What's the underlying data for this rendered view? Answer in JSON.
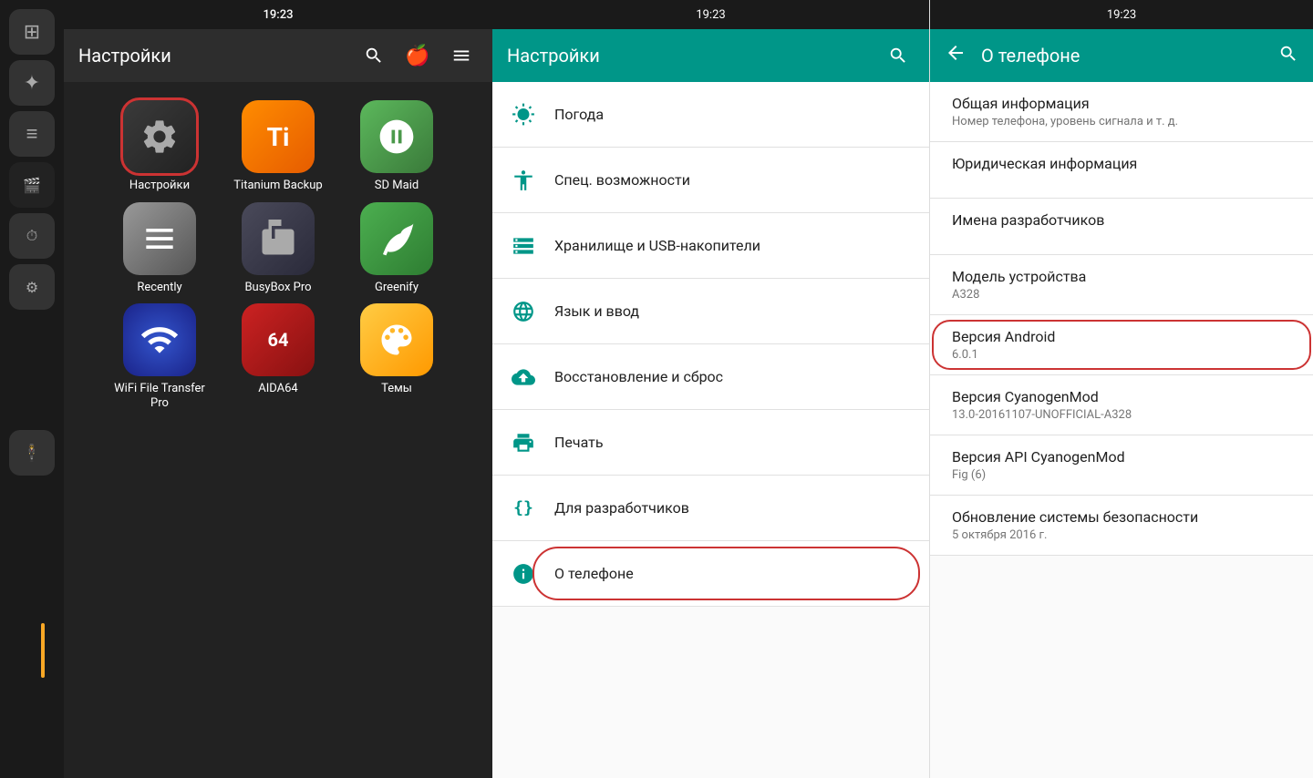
{
  "leftPanel": {
    "statusBar": {
      "time": "19:23"
    },
    "header": {
      "title": "Настройки",
      "searchIcon": "search",
      "appleIcon": "apple",
      "menuIcon": "menu"
    },
    "apps": [
      {
        "id": "settings",
        "label": "Настройки",
        "selected": true,
        "iconType": "settings"
      },
      {
        "id": "titanium",
        "label": "Titanium Backup",
        "iconType": "titanium",
        "iconText": "Ti"
      },
      {
        "id": "sdmaid",
        "label": "SD Maid",
        "iconType": "sdmaid"
      },
      {
        "id": "recently",
        "label": "Recently",
        "iconType": "recently"
      },
      {
        "id": "busybox",
        "label": "BusyBox Pro",
        "iconType": "busybox"
      },
      {
        "id": "greenify",
        "label": "Greenify",
        "iconType": "greenify"
      },
      {
        "id": "wifi",
        "label": "WiFi File Transfer Pro",
        "iconType": "wifi"
      },
      {
        "id": "aida64",
        "label": "AIDA64",
        "iconType": "aida"
      },
      {
        "id": "themes",
        "label": "Темы",
        "iconType": "themes"
      }
    ]
  },
  "middlePanel": {
    "statusBar": {
      "time": "19:23"
    },
    "header": {
      "title": "Настройки",
      "searchIcon": "search"
    },
    "items": [
      {
        "id": "weather",
        "label": "Погода",
        "icon": "☁"
      },
      {
        "id": "accessibility",
        "label": "Спец. возможности",
        "icon": "♿"
      },
      {
        "id": "storage",
        "label": "Хранилище и USB-накопители",
        "icon": "≡"
      },
      {
        "id": "language",
        "label": "Язык и ввод",
        "icon": "🌐"
      },
      {
        "id": "backup",
        "label": "Восстановление и сброс",
        "icon": "☁"
      },
      {
        "id": "print",
        "label": "Печать",
        "icon": "🖨"
      },
      {
        "id": "developer",
        "label": "Для разработчиков",
        "icon": "{}"
      },
      {
        "id": "about",
        "label": "О телефоне",
        "icon": "ℹ",
        "active": true
      }
    ]
  },
  "rightPanel": {
    "statusBar": {
      "time": "19:23"
    },
    "header": {
      "title": "О телефоне",
      "backIcon": "←",
      "searchIcon": "search"
    },
    "items": [
      {
        "id": "general",
        "title": "Общая информация",
        "subtitle": "Номер телефона, уровень сигнала и т. д."
      },
      {
        "id": "legal",
        "title": "Юридическая информация",
        "subtitle": ""
      },
      {
        "id": "developers",
        "title": "Имена разработчиков",
        "subtitle": ""
      },
      {
        "id": "model",
        "title": "Модель устройства",
        "subtitle": "A328"
      },
      {
        "id": "android",
        "title": "Версия Android",
        "subtitle": "6.0.1",
        "highlighted": true
      },
      {
        "id": "cyanogen",
        "title": "Версия CyanogenMod",
        "subtitle": "13.0-20161107-UNOFFICIAL-A328"
      },
      {
        "id": "api",
        "title": "Версия API CyanogenMod",
        "subtitle": "Fig (6)"
      },
      {
        "id": "security",
        "title": "Обновление системы безопасности",
        "subtitle": "5 октября 2016 г."
      }
    ]
  },
  "sidePanel": {
    "icons": [
      "⊞",
      "✦",
      "≡",
      "🎬",
      "⏱",
      "♟"
    ]
  }
}
